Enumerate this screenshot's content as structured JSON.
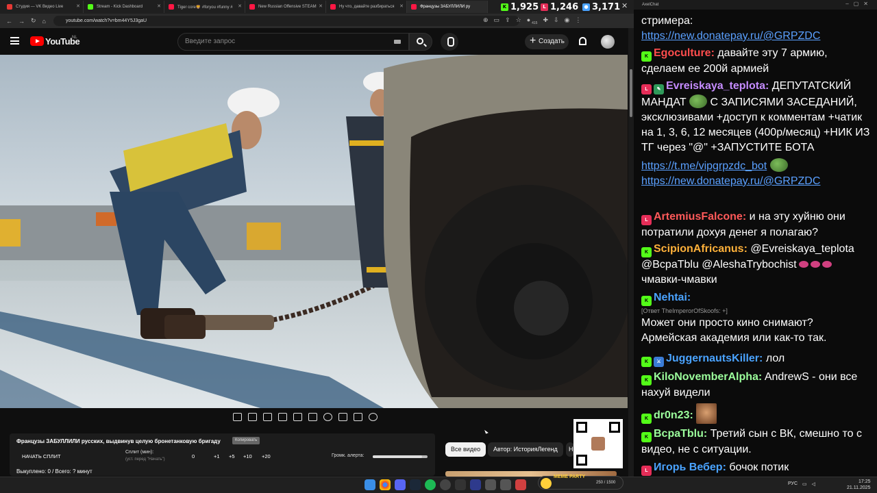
{
  "browser": {
    "tabs": [
      {
        "label": "Студия — VK Видео Live",
        "color": "#e53935"
      },
      {
        "label": "Stream - Kick Dashboard",
        "color": "#53fc18"
      },
      {
        "label": "Tiger core🦁 #foryou #funny #",
        "color": "#ff1744"
      },
      {
        "label": "New Russian Offensive STEAM",
        "color": "#ff1744"
      },
      {
        "label": "Ну что, давайте разбираться",
        "color": "#ff1744"
      },
      {
        "label": "Французы ЗАБУЛЛИЛИ ру",
        "color": "#ff1744",
        "active": true
      }
    ],
    "stats": {
      "kick": "1,925",
      "vk": "1,246",
      "viewers": "3,171"
    },
    "url": "youtube.com/watch?v=bm44Y5J3gaU",
    "ext_badge": "415"
  },
  "youtube": {
    "logo_text": "YouTube",
    "country": "NL",
    "search_placeholder": "Введите запрос",
    "create_label": "Создать"
  },
  "panel": {
    "title": "Французы ЗАБУЛЛИЛИ русских, выдвинув целую бронетанковую бригаду",
    "copy_label": "Копировать",
    "split_label": "НАЧАТЬ СПЛИТ",
    "split_min_label": "Сплит (мин):",
    "split_note": "(уст. перед \"Начать\")",
    "split_values": [
      "0",
      "+1",
      "+5",
      "+10",
      "+20"
    ],
    "alert_label": "Громк. алерта:",
    "alert_volume": 0.9,
    "bought": "Выкуплено: 0 / Всего: ? минут"
  },
  "chips": [
    "Все видео",
    "Автор: ИсторияЛегенд",
    "Н"
  ],
  "chat": {
    "window_title": "AxelChat",
    "messages": [
      {
        "text": "стримера:",
        "link": "https://new.donatepay.ru/@GRPZDC"
      },
      {
        "badge": "kick",
        "nick": "Egoculture:",
        "color": "#ff4d4d",
        "text": "давайте эту 7 армию, сделаем ее 200й армией"
      },
      {
        "badge": "live",
        "nick": "Evreiskaya_teplota:",
        "color": "#c58cff",
        "text_a": "ДЕПУТАТСКИЙ МАНДАТ",
        "text_b": "С ЗАПИСЯМИ ЗАСЕДАНИЙ, эксклюзивами +доступ к комментам +чатик на 1, 3, 6, 12 месяцев (400р/месяц) +НИК ИЗ ТГ через \"@\" +ЗАПУСТИТЕ БОТА",
        "link1": "https://t.me/vipgrpzdc_bot",
        "link2": "https://new.donatepay.ru/@GRPZDC"
      },
      {
        "badge": "live",
        "nick": "ArtemiusFalcone:",
        "color": "#ff5a5a",
        "text": "и на эту хуйню они потратили дохуя денег я полагаю?"
      },
      {
        "badge": "kick",
        "nick": "ScipionAfricanus:",
        "color": "#ffb13a",
        "text": "@Evreiskaya_teplota @BcpaTblu @AleshaTrybochist",
        "text_b": "чмавки-чмавки"
      },
      {
        "badge": "kick",
        "nick": "Nehtai:",
        "color": "#4aa3ff",
        "reply": "[Ответ TheImperorOfSkoofs: +]",
        "text": "Может они просто кино снимают? Армейская академия или как-то так."
      },
      {
        "badge": "kick",
        "nick": "JuggernautsKiller:",
        "color": "#4aa3ff",
        "text": "лол"
      },
      {
        "badge": "kick",
        "nick": "KiloNovemberAlpha:",
        "color": "#9cff9c",
        "text": "AndrewS - они все нахуй видели"
      },
      {
        "badge": "kick",
        "nick": "dr0n23:",
        "color": "#9cff9c",
        "text": ""
      },
      {
        "badge": "kick",
        "nick": "BcpaTblu:",
        "color": "#9cff9c",
        "text": "Третий сын с ВК, смешно то с видео, не с ситуации."
      },
      {
        "badge": "live",
        "nick": "Игорь Вебер:",
        "color": "#4aa3ff",
        "text": "бочок потик"
      }
    ]
  },
  "taskbar": {
    "meme_label": "MEME PARTY",
    "meme_count": "250 / 1500",
    "lang": "РУС",
    "time": "17:25",
    "date": "21.11.2025"
  }
}
